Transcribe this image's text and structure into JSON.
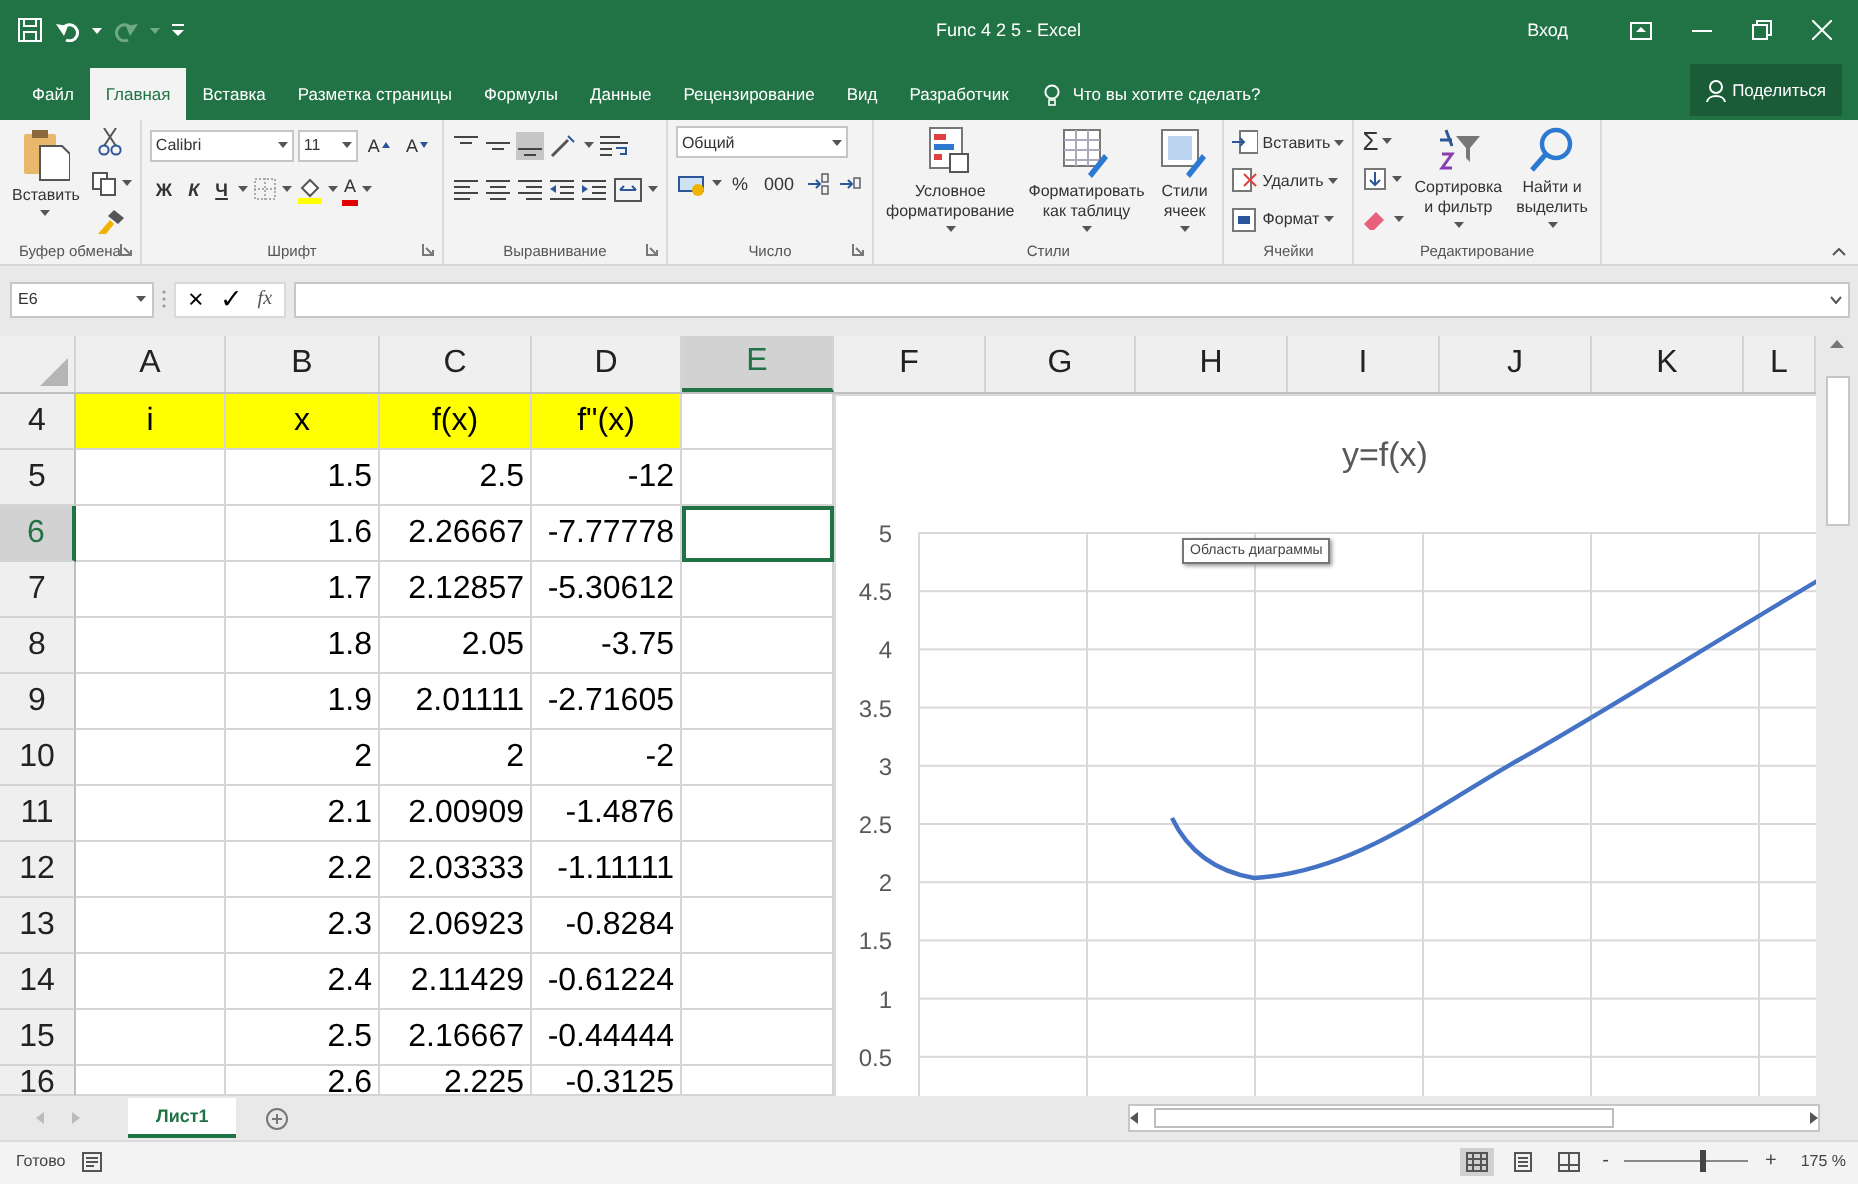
{
  "title_bar": {
    "title": "Func 4 2 5  -  Excel",
    "sign_in": "Вход"
  },
  "tabs": [
    {
      "label": "Файл",
      "selected": false
    },
    {
      "label": "Главная",
      "selected": true
    },
    {
      "label": "Вставка",
      "selected": false
    },
    {
      "label": "Разметка страницы",
      "selected": false
    },
    {
      "label": "Формулы",
      "selected": false
    },
    {
      "label": "Данные",
      "selected": false
    },
    {
      "label": "Рецензирование",
      "selected": false
    },
    {
      "label": "Вид",
      "selected": false
    },
    {
      "label": "Разработчик",
      "selected": false
    }
  ],
  "tell_me": {
    "placeholder": "Что вы хотите сделать?"
  },
  "share": "Поделиться",
  "ribbon": {
    "clipboard": {
      "label": "Буфер обмена",
      "paste": "Вставить"
    },
    "font": {
      "label": "Шрифт",
      "font_name": "Calibri",
      "font_size": "11",
      "grow": "A",
      "shrink": "A",
      "bold": "Ж",
      "italic": "К",
      "underline": "Ч",
      "font_color": "A"
    },
    "alignment": {
      "label": "Выравнивание"
    },
    "number": {
      "label": "Число",
      "format": "Общий",
      "percent": "%",
      "thousands": "000"
    },
    "styles": {
      "label": "Стили",
      "buttons": [
        {
          "lines": [
            "Условное",
            "форматирование"
          ]
        },
        {
          "lines": [
            "Форматировать",
            "как таблицу"
          ]
        },
        {
          "lines": [
            "Стили",
            "ячеек"
          ]
        }
      ]
    },
    "cells": {
      "label": "Ячейки",
      "buttons": [
        "Вставить",
        "Удалить",
        "Формат"
      ]
    },
    "editing": {
      "label": "Редактирование",
      "sum": "Σ",
      "buttons": [
        {
          "lines": [
            "Сортировка",
            "и фильтр"
          ]
        },
        {
          "lines": [
            "Найти и",
            "выделить"
          ]
        }
      ]
    }
  },
  "formula_bar": {
    "name_box": "E6",
    "cancel": "×",
    "enter": "✓",
    "function": "fx"
  },
  "columns": [
    {
      "label": "A",
      "selected": false
    },
    {
      "label": "B",
      "selected": false
    },
    {
      "label": "C",
      "selected": false
    },
    {
      "label": "D",
      "selected": false
    },
    {
      "label": "E",
      "selected": true
    },
    {
      "label": "F",
      "selected": false
    },
    {
      "label": "G",
      "selected": false
    },
    {
      "label": "H",
      "selected": false
    },
    {
      "label": "I",
      "selected": false
    },
    {
      "label": "J",
      "selected": false
    },
    {
      "label": "K",
      "selected": false
    },
    {
      "label": "L",
      "selected": false
    }
  ],
  "rows": [
    {
      "header": "4",
      "selected": false,
      "kind": "heading",
      "A": "i",
      "B": "x",
      "C": "f(x)",
      "D": "f\"(x)"
    },
    {
      "header": "5",
      "selected": false,
      "kind": "data",
      "B": "1.5",
      "C": "2.5",
      "D": "-12"
    },
    {
      "header": "6",
      "selected": true,
      "kind": "data",
      "B": "1.6",
      "C": "2.26667",
      "D": "-7.77778"
    },
    {
      "header": "7",
      "selected": false,
      "kind": "data",
      "B": "1.7",
      "C": "2.12857",
      "D": "-5.30612"
    },
    {
      "header": "8",
      "selected": false,
      "kind": "data",
      "B": "1.8",
      "C": "2.05",
      "D": "-3.75"
    },
    {
      "header": "9",
      "selected": false,
      "kind": "data",
      "B": "1.9",
      "C": "2.01111",
      "D": "-2.71605"
    },
    {
      "header": "10",
      "selected": false,
      "kind": "data",
      "B": "2",
      "C": "2",
      "D": "-2"
    },
    {
      "header": "11",
      "selected": false,
      "kind": "data",
      "B": "2.1",
      "C": "2.00909",
      "D": "-1.4876"
    },
    {
      "header": "12",
      "selected": false,
      "kind": "data",
      "B": "2.2",
      "C": "2.03333",
      "D": "-1.11111"
    },
    {
      "header": "13",
      "selected": false,
      "kind": "data",
      "B": "2.3",
      "C": "2.06923",
      "D": "-0.8284"
    },
    {
      "header": "14",
      "selected": false,
      "kind": "data",
      "B": "2.4",
      "C": "2.11429",
      "D": "-0.61224"
    },
    {
      "header": "15",
      "selected": false,
      "kind": "data",
      "B": "2.5",
      "C": "2.16667",
      "D": "-0.44444"
    },
    {
      "header": "16",
      "selected": false,
      "kind": "data",
      "B": "2.6",
      "C": "2.225",
      "D": "-0.3125"
    }
  ],
  "chart": {
    "title": "y=f(x)",
    "y_labels": [
      "5",
      "4.5",
      "4",
      "3.5",
      "3",
      "2.5",
      "2",
      "1.5",
      "1",
      "0.5"
    ],
    "tooltip": "Область диаграммы"
  },
  "sheet_tabs": [
    {
      "label": "Лист1",
      "selected": true
    }
  ],
  "status_bar": {
    "ready": "Готово",
    "views": [
      {
        "kind": "normal",
        "selected": true
      },
      {
        "kind": "page_layout",
        "selected": false
      },
      {
        "kind": "page_break",
        "selected": false
      }
    ],
    "zoom_out": "-",
    "zoom_in": "+",
    "zoom_slider": {
      "level": 0.62
    },
    "zoom": "175 %"
  }
}
